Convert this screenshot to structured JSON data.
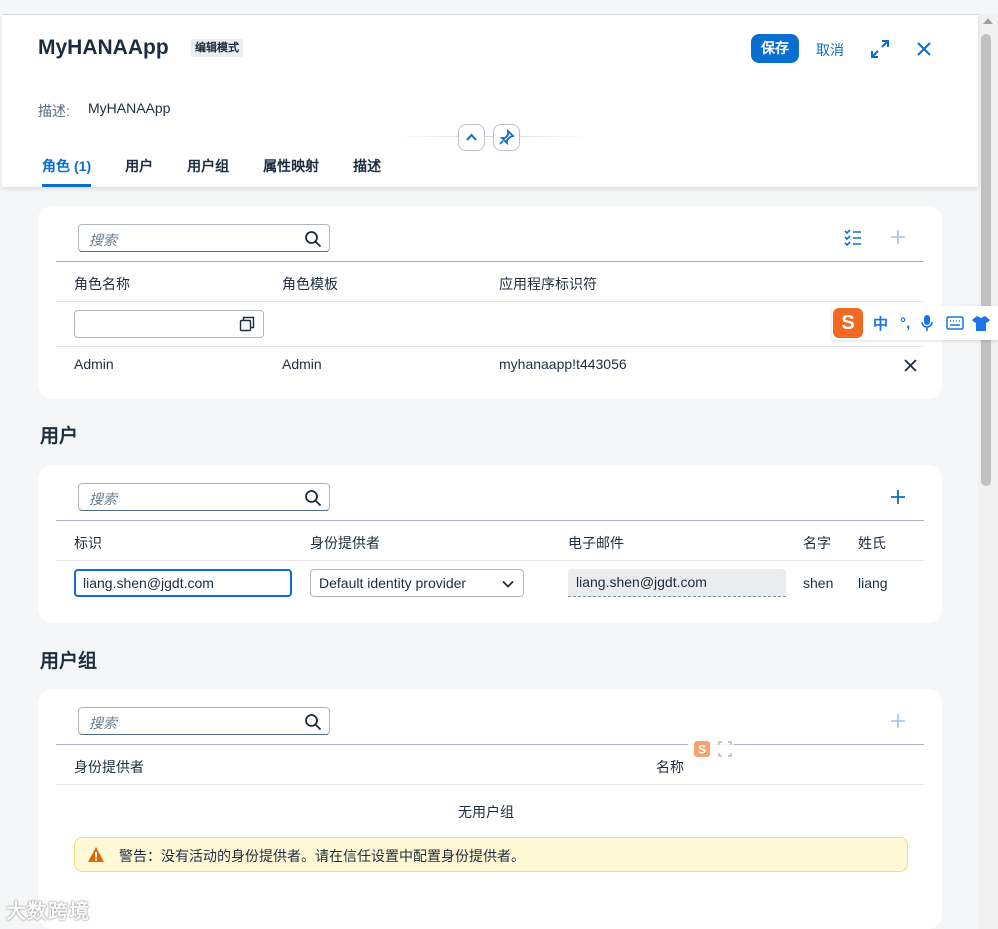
{
  "app": {
    "title": "MyHANAApp",
    "mode_badge": "编辑模式",
    "save_label": "保存",
    "cancel_label": "取消",
    "description_label": "描述:",
    "description_value": "MyHANAApp"
  },
  "tabs": [
    {
      "label": "角色",
      "count": "(1)",
      "active": true
    },
    {
      "label": "用户"
    },
    {
      "label": "用户组"
    },
    {
      "label": "属性映射"
    },
    {
      "label": "描述"
    }
  ],
  "roles": {
    "search_placeholder": "搜索",
    "columns": [
      "角色名称",
      "角色模板",
      "应用程序标识符"
    ],
    "rows": [
      {
        "name": "Admin",
        "template": "Admin",
        "app_id": "myhanaapp!t443056"
      }
    ]
  },
  "users": {
    "section_title": "用户",
    "search_placeholder": "搜索",
    "columns": [
      "标识",
      "身份提供者",
      "电子邮件",
      "名字",
      "姓氏"
    ],
    "rows": [
      {
        "id": "liang.shen@jgdt.com",
        "idp": "Default identity provider",
        "email": "liang.shen@jgdt.com",
        "first_name": "shen",
        "last_name": "liang"
      }
    ]
  },
  "user_groups": {
    "section_title": "用户组",
    "search_placeholder": "搜索",
    "columns": [
      "身份提供者",
      "名称"
    ],
    "empty_text": "无用户组",
    "warning": "警告：没有活动的身份提供者。请在信任设置中配置身份提供者。"
  },
  "ime": {
    "lang": "中",
    "punct": "°,"
  },
  "watermark": "大数跨境",
  "colors": {
    "accent": "#0a6ed1",
    "warning_bg": "#fff8d6",
    "warning_icon": "#e76500",
    "ime_orange": "#f26a21"
  }
}
